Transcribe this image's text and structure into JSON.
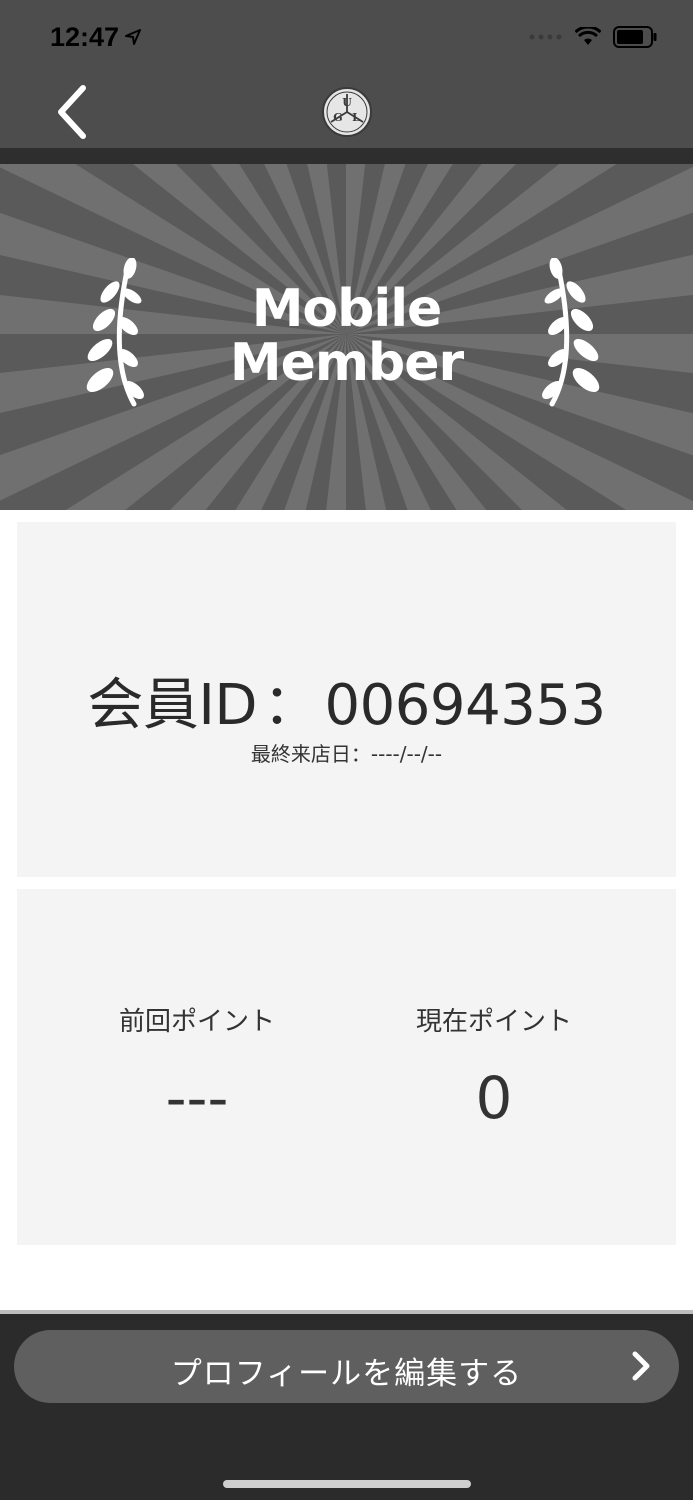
{
  "status_bar": {
    "time": "12:47",
    "icons": [
      "location-arrow-icon",
      "signal-dots-icon",
      "wifi-icon",
      "battery-icon"
    ]
  },
  "nav": {
    "back_icon": "chevron-left-icon",
    "logo_letters": [
      "U",
      "G",
      "L"
    ]
  },
  "banner": {
    "title_line1": "Mobile",
    "title_line2": "Member",
    "icons": [
      "laurel-left-icon",
      "laurel-right-icon"
    ]
  },
  "member": {
    "id_label": "会員ID",
    "id_separator": "：",
    "id_value": "00694353",
    "last_visit": "最終来店日：----/--/--"
  },
  "points": {
    "previous_label": "前回ポイント",
    "previous_value": "---",
    "current_label": "現在ポイント",
    "current_value": "0"
  },
  "footer": {
    "edit_profile_label": "プロフィールを編集する",
    "chevron_icon": "chevron-right-icon"
  },
  "colors": {
    "header_bg": "#4d4d4d",
    "banner_bg": "#5a5a5a",
    "card_bg": "#f4f4f4",
    "button_bg": "#5f5f5f",
    "footer_bg": "#2b2b2b"
  }
}
